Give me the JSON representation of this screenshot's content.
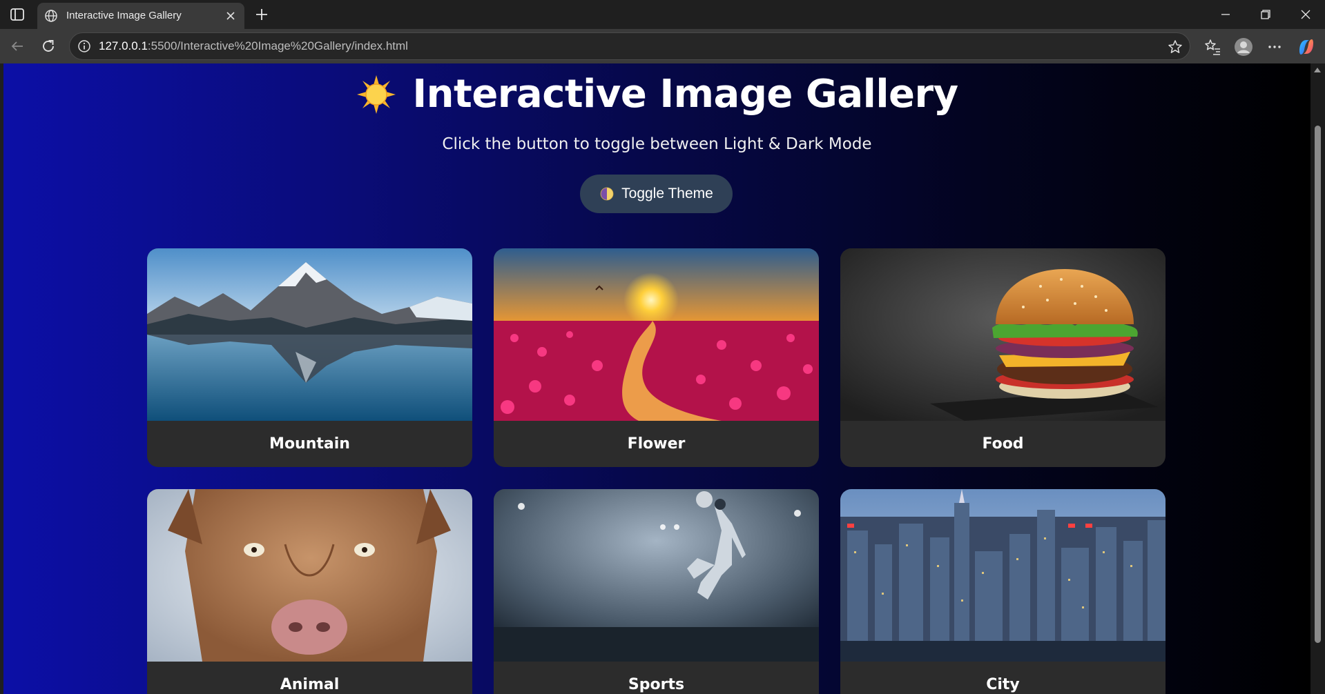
{
  "browser": {
    "tab_title": "Interactive Image Gallery",
    "url_host": "127.0.0.1",
    "url_path": ":5500/Interactive%20Image%20Gallery/index.html"
  },
  "page": {
    "title": "Interactive Image Gallery",
    "subtitle": "Click the button to toggle between Light & Dark Mode",
    "toggle_label": "Toggle Theme",
    "title_icon": "sun-icon",
    "button_icon": "theme-icon"
  },
  "gallery": [
    {
      "label": "Mountain"
    },
    {
      "label": "Flower"
    },
    {
      "label": "Food"
    },
    {
      "label": "Animal"
    },
    {
      "label": "Sports"
    },
    {
      "label": "City"
    }
  ],
  "colors": {
    "background_start": "#0c0fa6",
    "background_end": "#000000",
    "button_bg": "#2f4056",
    "card_bg": "#2c2c2c"
  }
}
